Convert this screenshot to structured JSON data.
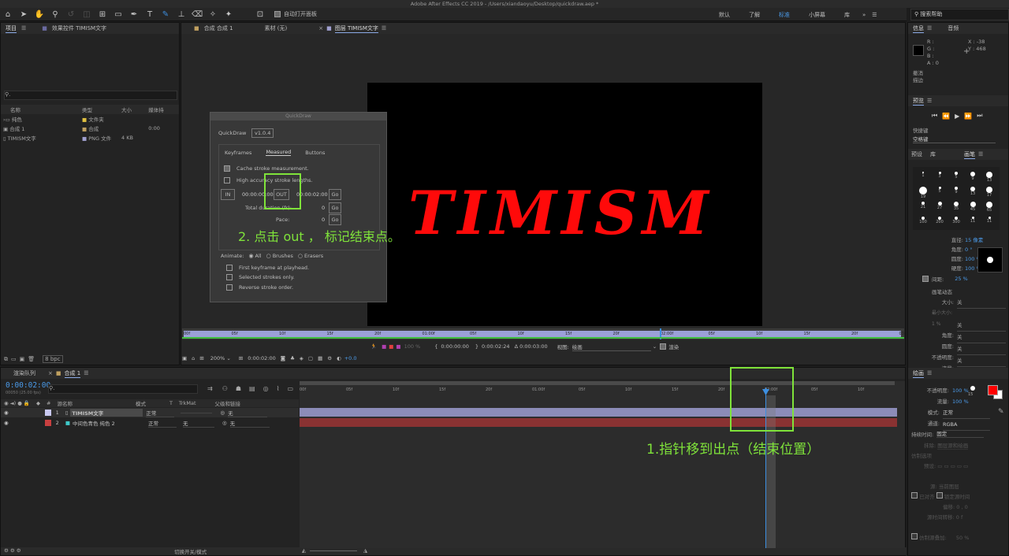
{
  "window_title": "Adobe After Effects CC 2019 - /Users/xiandaoyu/Desktop/quickdraw.aep *",
  "toolbar": {
    "auto_open_label": "自动打开面板",
    "workspaces": [
      "默认",
      "了解",
      "标准",
      "小屏幕",
      "库"
    ],
    "active_workspace": "标准",
    "search_placeholder": "搜索帮助"
  },
  "project_panel": {
    "tab_project": "项目",
    "tab_effects": "效果控件 TIMISM文字",
    "search_placeholder": "",
    "columns": [
      "名称",
      "类型",
      "大小",
      "媒体持"
    ],
    "rows": [
      {
        "name": "纯色",
        "type": "文件夹",
        "size": "",
        "dur": ""
      },
      {
        "name": "合成 1",
        "type": "合成",
        "size": "",
        "dur": "0:00"
      },
      {
        "name": "TIMISM文字",
        "type": "PNG 文件",
        "size": "4 KB",
        "dur": ""
      }
    ],
    "bpc": "8 bpc"
  },
  "viewer": {
    "tabs": [
      "合成 合成 1",
      "素材 (无)",
      "图层 TIMISM文字"
    ],
    "active_tab": "图层 TIMISM文字",
    "comp_text": "TIMISM",
    "ruler_labels": [
      "00f",
      "05f",
      "10f",
      "15f",
      "20f",
      "01:00f",
      "05f",
      "10f",
      "15f",
      "20f",
      "02:00f",
      "05f",
      "10f",
      "15f",
      "20f",
      "03:"
    ],
    "status": {
      "in_time": "0:00:00:00",
      "out_time": "0:00:02:24",
      "duration": "Δ 0:00:03:00",
      "view_label": "视图:",
      "view_value": "绘画",
      "render_label": "渲染",
      "zoom": "200%",
      "time": "0:00:02:00",
      "exposure": "+0.0",
      "opacity_pct": "100 %"
    }
  },
  "quickdraw": {
    "title": "QuickDraw",
    "name": "QuickDraw",
    "version": "v1.0.4",
    "tabs": [
      "Keyframes",
      "Measured",
      "Buttons"
    ],
    "active_tab": "Measured",
    "cache_label": "Cache stroke measurement.",
    "cache_checked": true,
    "high_acc_label": "High accuracy stroke lengths.",
    "high_acc_checked": false,
    "in_label": "IN",
    "in_time": "00:00:00:00",
    "out_label": "OUT",
    "out_time": "00:00:02:00",
    "go_label": "Go",
    "total_duration_label": "Total duration (fr):",
    "total_duration_value": "0",
    "pace_label": "Pace:",
    "pace_value": "0",
    "animate_label": "Animate:",
    "animate_options": [
      "All",
      "Brushes",
      "Erasers"
    ],
    "animate_selected": "All",
    "options": [
      "First keyframe at playhead.",
      "Selected strokes only.",
      "Reverse stroke order."
    ]
  },
  "annotations": {
    "step2": "2. 点击 out ， 标记结束点。",
    "step1": "1.指针移到出点（结束位置）"
  },
  "info_panel": {
    "tab_info": "信息",
    "tab_audio": "音频",
    "r": "R :",
    "g": "G :",
    "b": "B :",
    "a": "A : 0",
    "x": "X : -38",
    "y": "Y : 468",
    "undo": "撤消",
    "stroke": "描边"
  },
  "preview_panel": {
    "title": "预览",
    "shortcut_label": "快捷键",
    "shortcut_value": "空格键"
  },
  "brushes_panel": {
    "tabs": [
      "预设",
      "库",
      "画笔"
    ],
    "active_tab": "画笔",
    "sizes": [
      "1",
      "3",
      "5",
      "9",
      "13",
      "19",
      "5",
      "9",
      "13",
      "17",
      "21",
      "27",
      "35",
      "45",
      "65",
      "100",
      "200",
      "300",
      "11",
      "11"
    ],
    "diameter_label": "直径:",
    "diameter": "15 像素",
    "angle_label": "角度:",
    "angle": "0 °",
    "roundness_label": "圆度:",
    "roundness": "100 %",
    "hardness_label": "硬度:",
    "hardness": "100 %",
    "spacing_label": "间距:",
    "spacing": "25 %",
    "dynamics_label": "画笔动态",
    "size_label": "大小:",
    "size_val": "关",
    "min_size_label": "最小大小: 1 %",
    "angle2_label": "角度:",
    "angle2_val": "关",
    "roundness2_label": "圆度:",
    "roundness2_val": "关",
    "opacity_label": "不透明度:",
    "opacity_val": "关",
    "flow_label": "流量:",
    "flow_val": "关"
  },
  "paint_panel": {
    "title": "绘画",
    "opacity_label": "不透明度:",
    "opacity": "100 %",
    "flow_label": "流量:",
    "flow": "100 %",
    "mode_label": "模式:",
    "mode": "正常",
    "channel_label": "通道:",
    "channel": "RGBA",
    "duration_label": "持续时间:",
    "duration": "固定",
    "erase_label": "抹除:",
    "erase_val": "图层源和绘画",
    "clone_label": "仿制选项",
    "preset_label": "预设:",
    "source_label": "源:",
    "source_val": "当前图层",
    "aligned_label": "已对齐",
    "lock_label": "锁定源时间",
    "offset_label": "偏移:",
    "offset_val": "0 , 0",
    "srctime_label": "源时间转移:",
    "srctime_val": "0 f",
    "overlay_label": "仿制源叠加:",
    "overlay_val": "50 %",
    "brush_size": "15",
    "fg_color": "#ff0000",
    "bg_color": "#ffffff"
  },
  "timeline": {
    "tab_render": "渲染队列",
    "tab_comp": "合成 1",
    "current_time": "0:00:02:00",
    "fps": "00050 (25.00 fps)",
    "columns": [
      "源名称",
      "模式",
      "T",
      "TrkMat",
      "父级和链接"
    ],
    "layers": [
      {
        "num": "1",
        "name": "TIMISM文字",
        "mode": "正常",
        "trkmat": "",
        "parent": "无",
        "color": "#c8c8f0"
      },
      {
        "num": "2",
        "name": "中间色青色 纯色 2",
        "mode": "正常",
        "trkmat": "无",
        "parent": "无",
        "color": "#c84040"
      }
    ],
    "ruler_labels": [
      "00f",
      "05f",
      "10f",
      "15f",
      "20f",
      "01:00f",
      "05f",
      "10f",
      "15f",
      "20f",
      "02:00f",
      "05f",
      "10f"
    ],
    "toggle_label": "切换开关/模式"
  }
}
